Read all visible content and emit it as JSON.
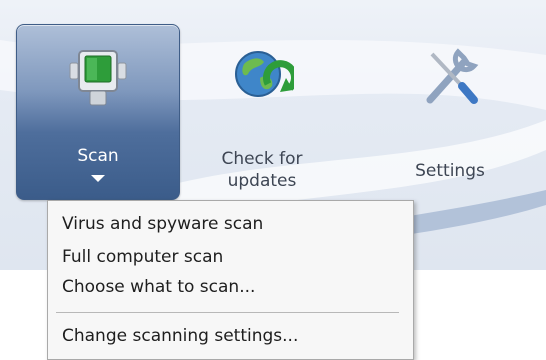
{
  "toolbar": {
    "buttons": [
      {
        "label": "Scan",
        "icon": "scanner-device-icon"
      },
      {
        "label": "Check for updates",
        "icon": "globe-refresh-icon"
      },
      {
        "label": "Settings",
        "icon": "tools-wrench-screwdriver-icon"
      }
    ]
  },
  "scan_menu": {
    "items": [
      {
        "label": "Virus and spyware scan"
      },
      {
        "label": "Full computer scan"
      },
      {
        "label": "Choose what to scan..."
      },
      {
        "label": "Change scanning settings..."
      }
    ]
  },
  "colors": {
    "scan_button_blue": "#4e6e9c",
    "menu_background": "#f7f7f7",
    "icon_green": "#2e9d3a"
  }
}
